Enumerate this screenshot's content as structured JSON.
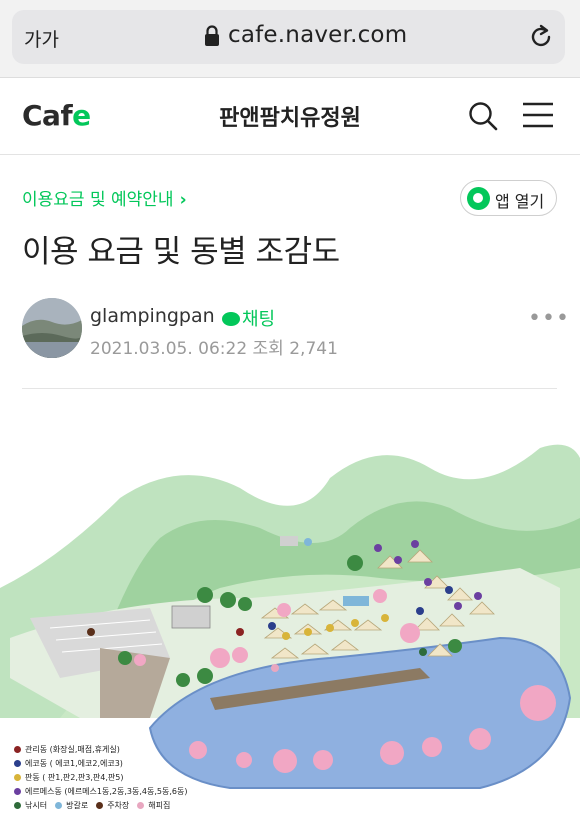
{
  "browser": {
    "text_size_label": "가가",
    "url": "cafe.naver.com"
  },
  "cafe": {
    "logo_text": "Cafe",
    "name": "판앤팜치유정원"
  },
  "article": {
    "breadcrumb": "이용요금 및 예약안내",
    "app_open_label": "앱 열기",
    "title": "이용 요금 및 동별 조감도",
    "author": "glampingpan",
    "chat_label": "채팅",
    "date": "2021.03.05. 06:22",
    "views_label": "조회 2,741"
  },
  "legend": {
    "items": [
      {
        "label": "관리동 (화장실,매점,휴게실)",
        "color": "#8b2323"
      },
      {
        "label": "에코동 ( 에코1,에코2,에코3)",
        "color": "#2b3f8c"
      },
      {
        "label": "판동 ( 판1,판2,판3,판4,판5)",
        "color": "#d8b43a"
      },
      {
        "label": "에르메스동 (에르메스1동,2동,3동,4동,5동,6동)",
        "color": "#6b3fa0"
      }
    ],
    "bottom_items": [
      {
        "label": "낚시터",
        "color": "#2f6b3a"
      },
      {
        "label": "방갈로",
        "color": "#7fb6d9"
      },
      {
        "label": "주차장",
        "color": "#5a2f1a"
      },
      {
        "label": "해피집",
        "color": "#e8a7c0"
      }
    ]
  },
  "colors": {
    "accent": "#03c75a"
  }
}
